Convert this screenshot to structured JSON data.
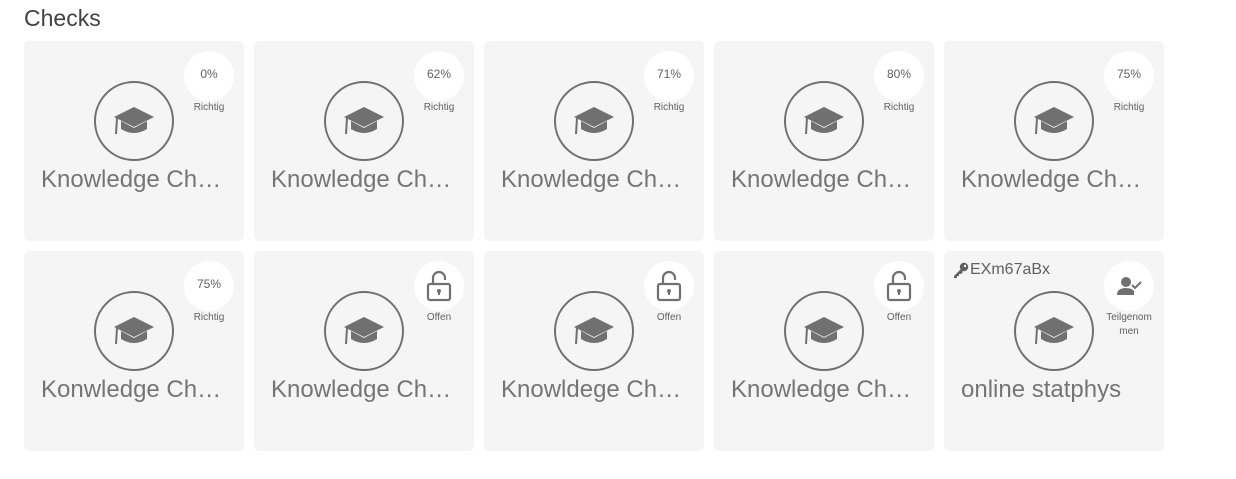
{
  "section": {
    "title": "Checks"
  },
  "cards": [
    {
      "title": "Knowledge Check",
      "status": "score",
      "score": "0%",
      "status_label": "Richtig"
    },
    {
      "title": "Knowledge Check",
      "status": "score",
      "score": "62%",
      "status_label": "Richtig"
    },
    {
      "title": "Knowledge Check",
      "status": "score",
      "score": "71%",
      "status_label": "Richtig"
    },
    {
      "title": "Knowledge Check",
      "status": "score",
      "score": "80%",
      "status_label": "Richtig"
    },
    {
      "title": "Knowledge Check",
      "status": "score",
      "score": "75%",
      "status_label": "Richtig"
    },
    {
      "title": "Konwledge Check",
      "status": "score",
      "score": "75%",
      "status_label": "Richtig"
    },
    {
      "title": "Knowledge Check",
      "status": "open",
      "status_label": "Offen"
    },
    {
      "title": "Knowldege Check",
      "status": "open",
      "status_label": "Offen"
    },
    {
      "title": "Knowledge Check",
      "status": "open",
      "status_label": "Offen"
    },
    {
      "title": "online statphys",
      "status": "participated",
      "status_label": "Teilgenom men",
      "code": "EXm67aBx"
    }
  ],
  "icons": {
    "course": "graduation-cap-icon",
    "open": "lock-open-icon",
    "participated": "user-check-icon",
    "code": "key-icon"
  },
  "colors": {
    "card_bg": "#f5f5f5",
    "icon": "#707070",
    "title_text": "#757575",
    "heading": "#424242"
  }
}
